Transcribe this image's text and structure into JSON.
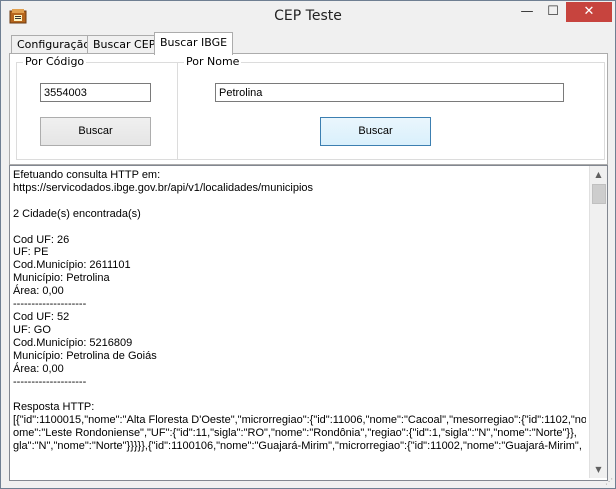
{
  "window": {
    "title": "CEP Teste",
    "minimize_icon": "minimize-icon",
    "maximize_icon": "maximize-icon",
    "close_icon": "close-icon",
    "app_icon": "app-icon",
    "min_glyph": "—",
    "max_glyph": "☐",
    "close_glyph": "✕"
  },
  "tabs": [
    {
      "label": "Configuração"
    },
    {
      "label": "Buscar CEP"
    },
    {
      "label": "Buscar IBGE"
    }
  ],
  "ibge": {
    "codigo": {
      "group_label": "Por Código",
      "value": "3554003",
      "button_label": "Buscar"
    },
    "nome": {
      "group_label": "Por Nome",
      "value": "Petrolina",
      "button_label": "Buscar"
    }
  },
  "output": {
    "text": "Efetuando consulta HTTP em:\nhttps://servicodados.ibge.gov.br/api/v1/localidades/municipios\n\n2 Cidade(s) encontrada(s)\n\nCod UF: 26\nUF: PE\nCod.Município: 2611101\nMunicípio: Petrolina\nÁrea: 0,00\n--------------------\nCod UF: 52\nUF: GO\nCod.Município: 5216809\nMunicípio: Petrolina de Goiás\nÁrea: 0,00\n--------------------\n\nResposta HTTP:\n[{\"id\":1100015,\"nome\":\"Alta Floresta D'Oeste\",\"microrregiao\":{\"id\":11006,\"nome\":\"Cacoal\",\"mesorregiao\":{\"id\":1102,\"no\nome\":\"Leste Rondoniense\",\"UF\":{\"id\":11,\"sigla\":\"RO\",\"nome\":\"Rondônia\",\"regiao\":{\"id\":1,\"sigla\":\"N\",\"nome\":\"Norte\"}},\ngla\":\"N\",\"nome\":\"Norte\"}}}}},{\"id\":1100106,\"nome\":\"Guajará-Mirim\",\"microrregiao\":{\"id\":11002,\"nome\":\"Guajará-Mirim\","
  }
}
